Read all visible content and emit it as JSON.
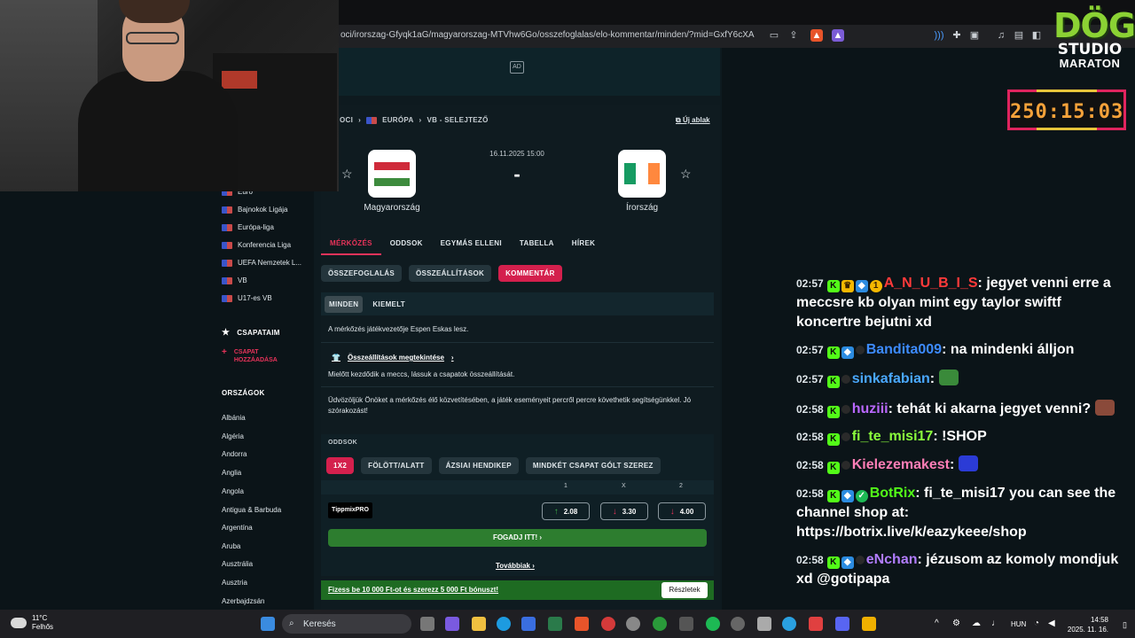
{
  "browser": {
    "url": "oci/irorszag-Gfyqk1aG/magyarorszag-MTVhw6Go/osszefoglalas/elo-kommentar/minden/?mid=GxfY6cXA"
  },
  "ad": {
    "label": "AD"
  },
  "breadcrumb": {
    "items": [
      "OCI",
      "EURÓPA",
      "VB - SELEJTEZŐ"
    ],
    "new_window": "Új ablak"
  },
  "match": {
    "date": "16.11.2025 15:00",
    "score": "-",
    "home": "Magyarország",
    "away": "Írország"
  },
  "tabs": [
    "MÉRKŐZÉS",
    "ODDSOK",
    "EGYMÁS ELLENI",
    "TABELLA",
    "HÍREK"
  ],
  "subtabs": [
    "ÖSSZEFOGLALÁS",
    "ÖSSZEÁLLÍTÁSOK",
    "KOMMENTÁR"
  ],
  "filters": [
    "MINDEN",
    "KIEMELT"
  ],
  "commentary": {
    "referee": "A mérkőzés játékvezetője Espen Eskas lesz.",
    "lineups_link": "Összeállítások megtekintése",
    "before_start": "Mielőtt kezdődik a meccs, lássuk a csapatok összeállítását.",
    "welcome": "Üdvözöljük Önöket a mérkőzés élő közvetítésében, a játék eseményeit percről percre követhetik segítségünkkel. Jó szórakozást!"
  },
  "odds": {
    "title": "ODDSOK",
    "tabs": [
      "1X2",
      "FÖLÖTT/ALATT",
      "ÁZSIAI HENDIKEP",
      "MINDKÉT CSAPAT GÓLT SZEREZ"
    ],
    "headers": [
      "1",
      "X",
      "2"
    ],
    "bookmaker": "TippmixPRO",
    "values": [
      "2.08",
      "3.30",
      "4.00"
    ],
    "bet_button": "FOGADJ ITT! ›",
    "more": "Továbbiak ›",
    "promo": "Fizess be 10 000 Ft-ot és szerezz 5 000 Ft bónuszt!",
    "promo_button": "Részletek"
  },
  "nav": {
    "leagues": [
      "Euro",
      "Bajnokok Ligája",
      "Európa-liga",
      "Konferencia Liga",
      "UEFA Nemzetek L...",
      "VB",
      "U17-es VB"
    ],
    "my_teams": "CSAPATAIM",
    "add_team": [
      "CSAPAT",
      "HOZZÁADÁSA"
    ],
    "countries_title": "ORSZÁGOK",
    "countries": [
      "Albánia",
      "Algéria",
      "Andorra",
      "Anglia",
      "Angola",
      "Antigua & Barbuda",
      "Argentína",
      "Aruba",
      "Ausztrália",
      "Ausztria",
      "Azerbajdzsán"
    ]
  },
  "overlay": {
    "logo": [
      "DÖG",
      "STUDIO",
      "MARATON"
    ],
    "timer": "250:15:03"
  },
  "chat": [
    {
      "time": "02:57",
      "user": "A_N_U_B_I_S",
      "color": "#ff3a3a",
      "text": "jegyet venni erre a meccsre kb olyan mint egy taylor swiftf koncertre bejutni xd"
    },
    {
      "time": "02:57",
      "user": "Bandita009",
      "color": "#3d8bff",
      "text": "na mindenki álljon"
    },
    {
      "time": "02:57",
      "user": "sinkafabian",
      "color": "#4aa8ff",
      "text": ""
    },
    {
      "time": "02:58",
      "user": "huziii",
      "color": "#b967ff",
      "text": "tehát ki akarna jegyet venni?"
    },
    {
      "time": "02:58",
      "user": "fi_te_misi17",
      "color": "#8bff3c",
      "text": "!SHOP"
    },
    {
      "time": "02:58",
      "user": "Kielezemakest",
      "color": "#ff7eb6",
      "text": ""
    },
    {
      "time": "02:58",
      "user": "BotRix",
      "color": "#53fc18",
      "text": "fi_te_misi17 you can see the channel shop at: https://botrix.live/k/eazykeee/shop"
    },
    {
      "time": "02:58",
      "user": "eNchan",
      "color": "#b27dff",
      "text": "jézusom az komoly mondjuk xd @gotipapa"
    }
  ],
  "taskbar": {
    "temp": "11°C",
    "condition": "Felhős",
    "search": "Keresés",
    "lang": "HUN",
    "time": "14:58",
    "date": "2025. 11. 16."
  }
}
